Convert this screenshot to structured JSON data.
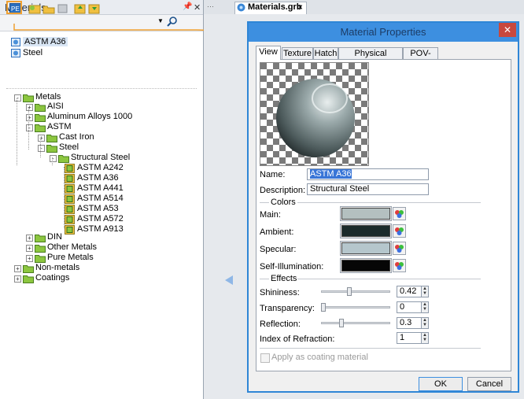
{
  "left_panel": {
    "title": "Materials",
    "materials_list": [
      "ASTM A36",
      "Steel"
    ],
    "tree": {
      "metals": "Metals",
      "aisi": "AISI",
      "aluminum": "Aluminum Alloys 1000",
      "astm": "ASTM",
      "cast_iron": "Cast Iron",
      "steel": "Steel",
      "structural_steel": "Structural Steel",
      "leaves": [
        "ASTM A242",
        "ASTM A36",
        "ASTM A441",
        "ASTM A514",
        "ASTM A53",
        "ASTM A572",
        "ASTM A913"
      ],
      "din": "DIN",
      "other_metals": "Other Metals",
      "pure_metals": "Pure Metals",
      "non_metals": "Non-metals",
      "coatings": "Coatings"
    }
  },
  "document_tab": {
    "label": "Materials.grb",
    "close": "×"
  },
  "dialog": {
    "title": "Material Properties",
    "close": "✕",
    "tabs": [
      "View",
      "Texture",
      "Hatch",
      "Physical Properties",
      "POV-Ray"
    ],
    "name_label": "Name:",
    "name_value": "ASTM A36",
    "description_label": "Description:",
    "description_value": "Structural Steel",
    "colors_header": "Colors",
    "main_label": "Main:",
    "ambient_label": "Ambient:",
    "specular_label": "Specular:",
    "self_illumination_label": "Self-Illumination:",
    "colors": {
      "main": "#b4c0c0",
      "ambient": "#1b2b2b",
      "specular": "#b5c6cc",
      "self_illumination": "#060606"
    },
    "effects_header": "Effects",
    "shininess_label": "Shininess:",
    "shininess_value": "0.42",
    "transparency_label": "Transparency:",
    "transparency_value": "0",
    "reflection_label": "Reflection:",
    "reflection_value": "0.3",
    "refraction_label": "Index of Refraction:",
    "refraction_value": "1",
    "coating_label": "Apply as coating material",
    "ok": "OK",
    "cancel": "Cancel"
  },
  "accent": {
    "dialog_border": "#2f86d6",
    "highlight": "#f0a030",
    "folder_green": "#8cc63f"
  }
}
